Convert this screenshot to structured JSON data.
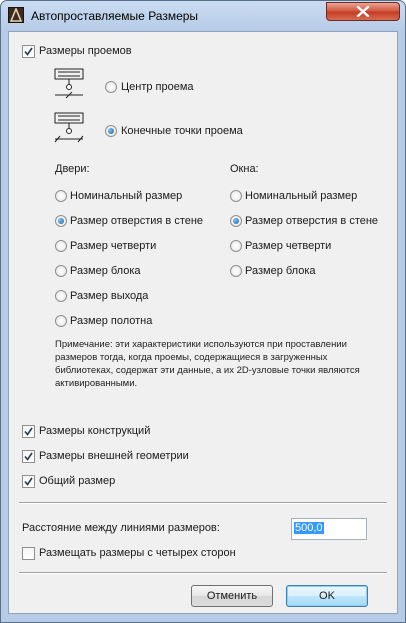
{
  "window": {
    "title": "Автопроставляемые Размеры"
  },
  "openings": {
    "checkbox_label": "Размеры проемов",
    "checked": true,
    "option_center": "Центр проема",
    "option_endpoints": "Конечные точки проема",
    "selected": "endpoints"
  },
  "doors": {
    "header": "Двери:",
    "options": [
      "Номинальный размер",
      "Размер отверстия в стене",
      "Размер четверти",
      "Размер блока",
      "Размер выхода",
      "Размер полотна"
    ],
    "selected_index": 1
  },
  "windows": {
    "header": "Окна:",
    "options": [
      "Номинальный размер",
      "Размер отверстия в стене",
      "Размер четверти",
      "Размер блока"
    ],
    "selected_index": 1
  },
  "note": "Примечание: эти характеристики используются при проставлении размеров тогда, когда проемы, содержащиеся в загруженных библиотеках, содержат эти данные, а их 2D-узловые точки являются активированными.",
  "checks": {
    "structures": {
      "label": "Размеры конструкций",
      "checked": true
    },
    "external": {
      "label": "Размеры внешней геометрии",
      "checked": true
    },
    "overall": {
      "label": "Общий размер",
      "checked": true
    }
  },
  "spacing": {
    "label": "Расстояние между линиями размеров:",
    "value": "500,0"
  },
  "four_sides": {
    "label": "Размещать размеры с четырех сторон",
    "checked": false
  },
  "buttons": {
    "cancel": "Отменить",
    "ok": "OK"
  },
  "colors": {
    "selection": "#3399ff",
    "title_close": "#c23d25"
  }
}
